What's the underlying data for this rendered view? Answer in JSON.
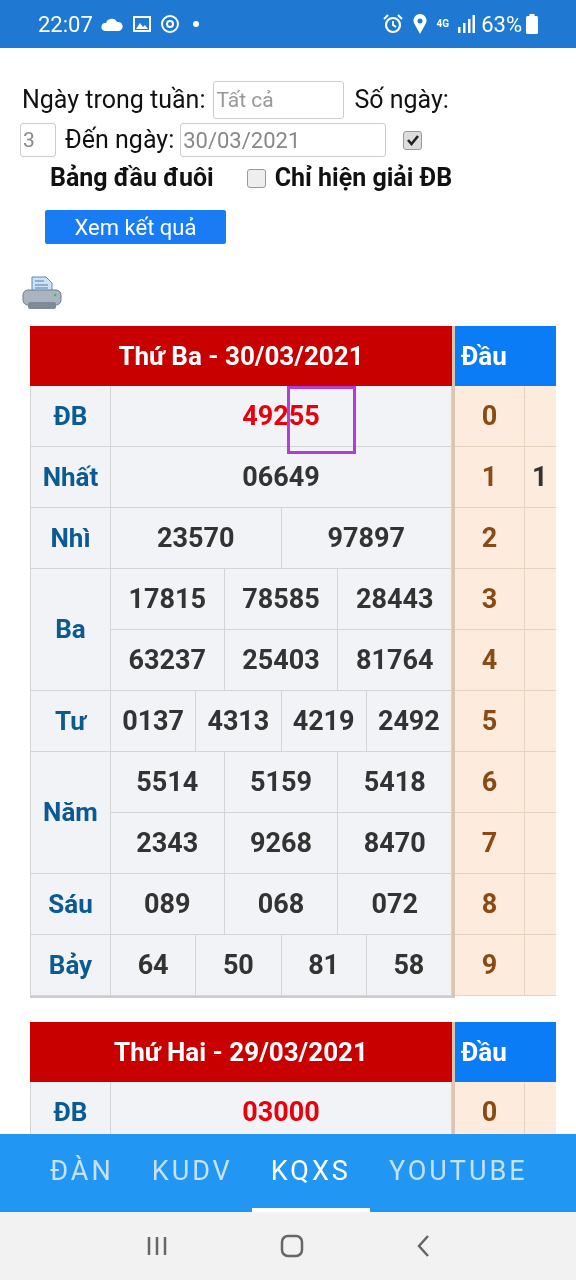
{
  "status_bar": {
    "time": "22:07",
    "network": "4G",
    "battery": "63%"
  },
  "form": {
    "weekday_label": "Ngày trong tuần:",
    "weekday_placeholder": "Tất cả",
    "days_label": "Số ngày:",
    "days_value": "3",
    "to_date_label": "Đến ngày:",
    "to_date_value": "30/03/2021",
    "head_tail_checked": true,
    "head_tail_label": "Bảng đầu đuôi",
    "special_only_checked": false,
    "special_only_label": "Chỉ hiện giải ĐB",
    "submit": "Xem kết quả"
  },
  "draws": [
    {
      "title": "Thứ Ba - 30/03/2021",
      "head_title": "Đầu",
      "prizes": [
        {
          "name": "ĐB",
          "kind": "special",
          "rows": [
            [
              "49255"
            ]
          ]
        },
        {
          "name": "Nhất",
          "kind": "normal",
          "rows": [
            [
              "06649"
            ]
          ]
        },
        {
          "name": "Nhì",
          "kind": "normal",
          "rows": [
            [
              "23570",
              "97897"
            ]
          ]
        },
        {
          "name": "Ba",
          "kind": "normal",
          "rows": [
            [
              "17815",
              "78585",
              "28443"
            ],
            [
              "63237",
              "25403",
              "81764"
            ]
          ]
        },
        {
          "name": "Tư",
          "kind": "normal",
          "rows": [
            [
              "0137",
              "4313",
              "4219",
              "2492"
            ]
          ]
        },
        {
          "name": "Năm",
          "kind": "normal",
          "rows": [
            [
              "5514",
              "5159",
              "5418"
            ],
            [
              "2343",
              "9268",
              "8470"
            ]
          ]
        },
        {
          "name": "Sáu",
          "kind": "normal",
          "rows": [
            [
              "089",
              "068",
              "072"
            ]
          ]
        },
        {
          "name": "Bảy",
          "kind": "normal",
          "rows": [
            [
              "64",
              "50",
              "81",
              "58"
            ]
          ]
        }
      ],
      "heads": [
        {
          "head": "0"
        },
        {
          "head": "1",
          "tail": "1"
        },
        {
          "head": "2"
        },
        {
          "head": "3"
        },
        {
          "head": "4"
        },
        {
          "head": "5"
        },
        {
          "head": "6"
        },
        {
          "head": "7"
        },
        {
          "head": "8"
        },
        {
          "head": "9"
        }
      ]
    },
    {
      "title": "Thứ Hai - 29/03/2021",
      "head_title": "Đầu",
      "prizes": [
        {
          "name": "ĐB",
          "kind": "special",
          "rows": [
            [
              "03000"
            ]
          ]
        }
      ],
      "heads": [
        {
          "head": "0"
        }
      ]
    }
  ],
  "tabs": [
    {
      "label": "ĐÀN",
      "selected": false
    },
    {
      "label": "KUDV",
      "selected": false
    },
    {
      "label": "KQXS",
      "selected": true
    },
    {
      "label": "YOUTUBE",
      "selected": false
    }
  ]
}
